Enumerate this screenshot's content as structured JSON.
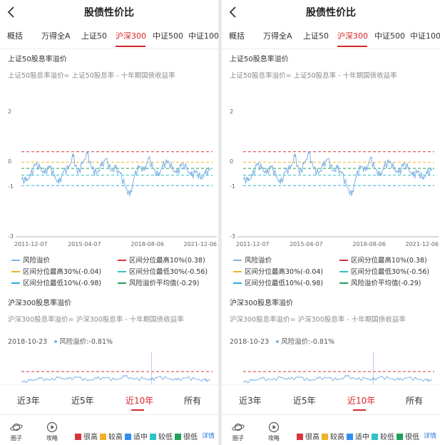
{
  "page": {
    "title": "股债性价比",
    "tabs": [
      {
        "label": "概括",
        "active": false
      },
      {
        "label": "万得全A",
        "active": false
      },
      {
        "label": "上证50",
        "active": false
      },
      {
        "label": "沪深300",
        "active": true
      },
      {
        "label": "中证500",
        "active": false
      },
      {
        "label": "中证1000",
        "active": false
      }
    ],
    "section1": {
      "title": "上证50股息率溢价",
      "formula": "上证50股息率溢价= 上证50股息率 - 十年期国债收益率"
    },
    "section2": {
      "title": "沪深300股息率溢价",
      "formula": "沪深300股息率溢价= 沪深300股息率 - 十年期国债收益率",
      "date": "2018-10-23",
      "value_label": "风险溢价:-0.81%"
    },
    "legend": [
      {
        "label": "风险溢价",
        "color": "#7fb2e5",
        "style": "solid"
      },
      {
        "label": "区间分位最高10%(0.38)",
        "color": "#d9343c",
        "style": "dashed"
      },
      {
        "label": "区间分位最高30%(-0.04)",
        "color": "#f2b12b",
        "style": "dashed"
      },
      {
        "label": "区间分位最低30%(-0.56)",
        "color": "#2fc2c7",
        "style": "dashed"
      },
      {
        "label": "区间分位最低10%(-0.98)",
        "color": "#26aee4",
        "style": "dashed"
      },
      {
        "label": "风险溢价平均值(-0.29)",
        "color": "#20a05a",
        "style": "dashed"
      }
    ],
    "ranges": [
      {
        "label": "近3年",
        "active": false
      },
      {
        "label": "近5年",
        "active": false
      },
      {
        "label": "近10年",
        "active": true
      },
      {
        "label": "所有",
        "active": false
      }
    ],
    "toolbar": {
      "quanzi": "圈子",
      "gonglue": "攻略",
      "levels": [
        {
          "label": "很高",
          "color": "#d9343c"
        },
        {
          "label": "较高",
          "color": "#f2b12b"
        },
        {
          "label": "适中",
          "color": "#2f8ff0"
        },
        {
          "label": "较低",
          "color": "#2fc2c7"
        },
        {
          "label": "很低",
          "color": "#20a05a"
        }
      ],
      "detail": "详情"
    }
  },
  "chart_data": [
    {
      "type": "line",
      "title": "上证50股息率溢价",
      "x_ticks": [
        "2011-12-07",
        "2015-04-07",
        "2018-08-06",
        "2021-12-06"
      ],
      "x_range": [
        "2011-12-07",
        "2022-01-15"
      ],
      "ylim": [
        -3,
        2
      ],
      "y_ticks": [
        -3,
        -1,
        0,
        2
      ],
      "grid": false,
      "legend_position": "bottom",
      "series": [
        {
          "name": "风险溢价",
          "x": [
            "2011-12-07",
            "2012-03-01",
            "2012-06-01",
            "2012-09-01",
            "2012-12-01",
            "2013-03-01",
            "2013-06-01",
            "2013-09-01",
            "2013-12-01",
            "2014-03-01",
            "2014-06-01",
            "2014-09-01",
            "2014-12-01",
            "2015-03-01",
            "2015-06-01",
            "2015-09-01",
            "2015-12-01",
            "2016-03-01",
            "2016-06-01",
            "2016-09-01",
            "2016-12-01",
            "2017-03-01",
            "2017-06-01",
            "2017-09-01",
            "2017-12-01",
            "2018-03-01",
            "2018-06-01",
            "2018-09-01",
            "2018-12-01",
            "2019-03-01",
            "2019-06-01",
            "2019-09-01",
            "2019-12-01",
            "2020-03-01",
            "2020-06-01",
            "2020-09-01",
            "2020-12-01",
            "2021-03-01",
            "2021-06-01",
            "2021-09-01",
            "2021-12-06"
          ],
          "values": [
            -0.7,
            -0.8,
            -0.6,
            -0.1,
            -0.3,
            -0.5,
            -0.2,
            -0.6,
            -0.9,
            -0.4,
            -0.3,
            0.2,
            -0.5,
            -0.1,
            0.3,
            -0.3,
            -0.5,
            -0.2,
            0.1,
            -0.4,
            -0.3,
            -0.5,
            -1.0,
            -1.4,
            -0.6,
            -0.2,
            -0.4,
            0.1,
            -0.3,
            -0.6,
            -0.2,
            0.0,
            -0.3,
            -0.5,
            -0.1,
            -0.3,
            -0.6,
            -0.4,
            -0.7,
            -0.5,
            -0.3
          ]
        },
        {
          "name": "区间分位最高10%(0.38)",
          "values": [
            0.38
          ]
        },
        {
          "name": "区间分位最高30%(-0.04)",
          "values": [
            -0.04
          ]
        },
        {
          "name": "区间分位最低30%(-0.56)",
          "values": [
            -0.56
          ]
        },
        {
          "name": "区间分位最低10%(-0.98)",
          "values": [
            -0.98
          ]
        },
        {
          "name": "风险溢价平均值(-0.29)",
          "values": [
            -0.29
          ]
        }
      ]
    },
    {
      "type": "line",
      "title": "沪深300股息率溢价",
      "x_range": [
        "2011-12-07",
        "2022-01-15"
      ],
      "series": [
        {
          "name": "风险溢价",
          "x": [
            "2011-12-07",
            "2012-06-01",
            "2012-12-01",
            "2013-06-01",
            "2013-12-01",
            "2014-06-01",
            "2014-12-01",
            "2015-06-01",
            "2015-12-01",
            "2016-06-01",
            "2016-12-01",
            "2017-06-01",
            "2017-12-01",
            "2018-06-01",
            "2018-10-23",
            "2019-03-01",
            "2019-09-01",
            "2020-03-01",
            "2020-09-01",
            "2021-03-01",
            "2021-09-01",
            "2021-12-06"
          ],
          "values": [
            -1.1,
            -0.9,
            -0.6,
            -0.8,
            -0.5,
            -0.7,
            -0.4,
            -0.9,
            -0.6,
            -0.5,
            -0.8,
            -0.3,
            -0.7,
            -0.6,
            -0.81,
            -0.4,
            -0.6,
            -0.8,
            -0.5,
            -0.7,
            -0.9,
            -0.8
          ]
        },
        {
          "name": "区间分位最高10%(0.38)",
          "values": [
            0.38
          ]
        }
      ]
    }
  ]
}
